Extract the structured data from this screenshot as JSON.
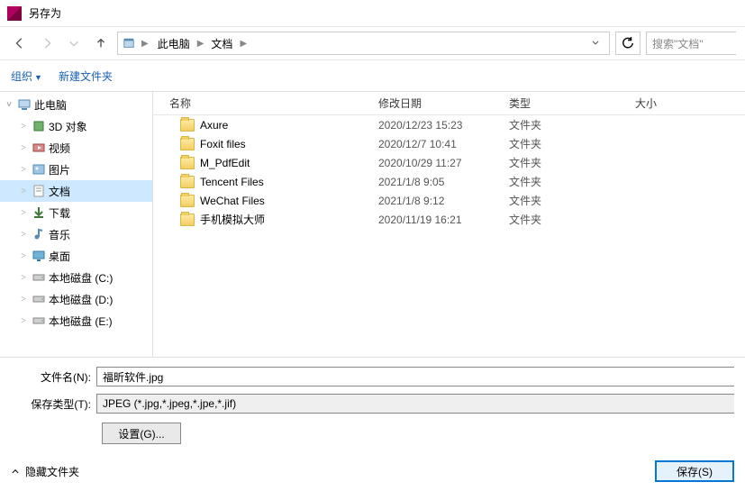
{
  "title": "另存为",
  "breadcrumbs": [
    "此电脑",
    "文档"
  ],
  "search_placeholder": "搜索\"文档\"",
  "toolbar": {
    "organize": "组织",
    "new_folder": "新建文件夹"
  },
  "columns": {
    "name": "名称",
    "date": "修改日期",
    "type": "类型",
    "size": "大小"
  },
  "tree": [
    {
      "label": "此电脑",
      "level": 1,
      "expanded": true,
      "icon": "pc"
    },
    {
      "label": "3D 对象",
      "level": 2,
      "icon": "3d"
    },
    {
      "label": "视频",
      "level": 2,
      "icon": "video"
    },
    {
      "label": "图片",
      "level": 2,
      "icon": "picture"
    },
    {
      "label": "文档",
      "level": 2,
      "icon": "doc",
      "selected": true
    },
    {
      "label": "下载",
      "level": 2,
      "icon": "download"
    },
    {
      "label": "音乐",
      "level": 2,
      "icon": "music"
    },
    {
      "label": "桌面",
      "level": 2,
      "icon": "desktop"
    },
    {
      "label": "本地磁盘 (C:)",
      "level": 2,
      "icon": "disk"
    },
    {
      "label": "本地磁盘 (D:)",
      "level": 2,
      "icon": "disk"
    },
    {
      "label": "本地磁盘 (E:)",
      "level": 2,
      "icon": "disk"
    }
  ],
  "files": [
    {
      "name": "Axure",
      "date": "2020/12/23 15:23",
      "type": "文件夹"
    },
    {
      "name": "Foxit files",
      "date": "2020/12/7 10:41",
      "type": "文件夹"
    },
    {
      "name": "M_PdfEdit",
      "date": "2020/10/29 11:27",
      "type": "文件夹"
    },
    {
      "name": "Tencent Files",
      "date": "2021/1/8 9:05",
      "type": "文件夹"
    },
    {
      "name": "WeChat Files",
      "date": "2021/1/8 9:12",
      "type": "文件夹"
    },
    {
      "name": "手机模拟大师",
      "date": "2020/11/19 16:21",
      "type": "文件夹"
    }
  ],
  "labels": {
    "filename": "文件名(N):",
    "filetype": "保存类型(T):",
    "settings": "设置(G)...",
    "hide_folders": "隐藏文件夹",
    "save": "保存(S)"
  },
  "filename_value": "福昕软件.jpg",
  "filetype_value": "JPEG (*.jpg,*.jpeg,*.jpe,*.jif)"
}
